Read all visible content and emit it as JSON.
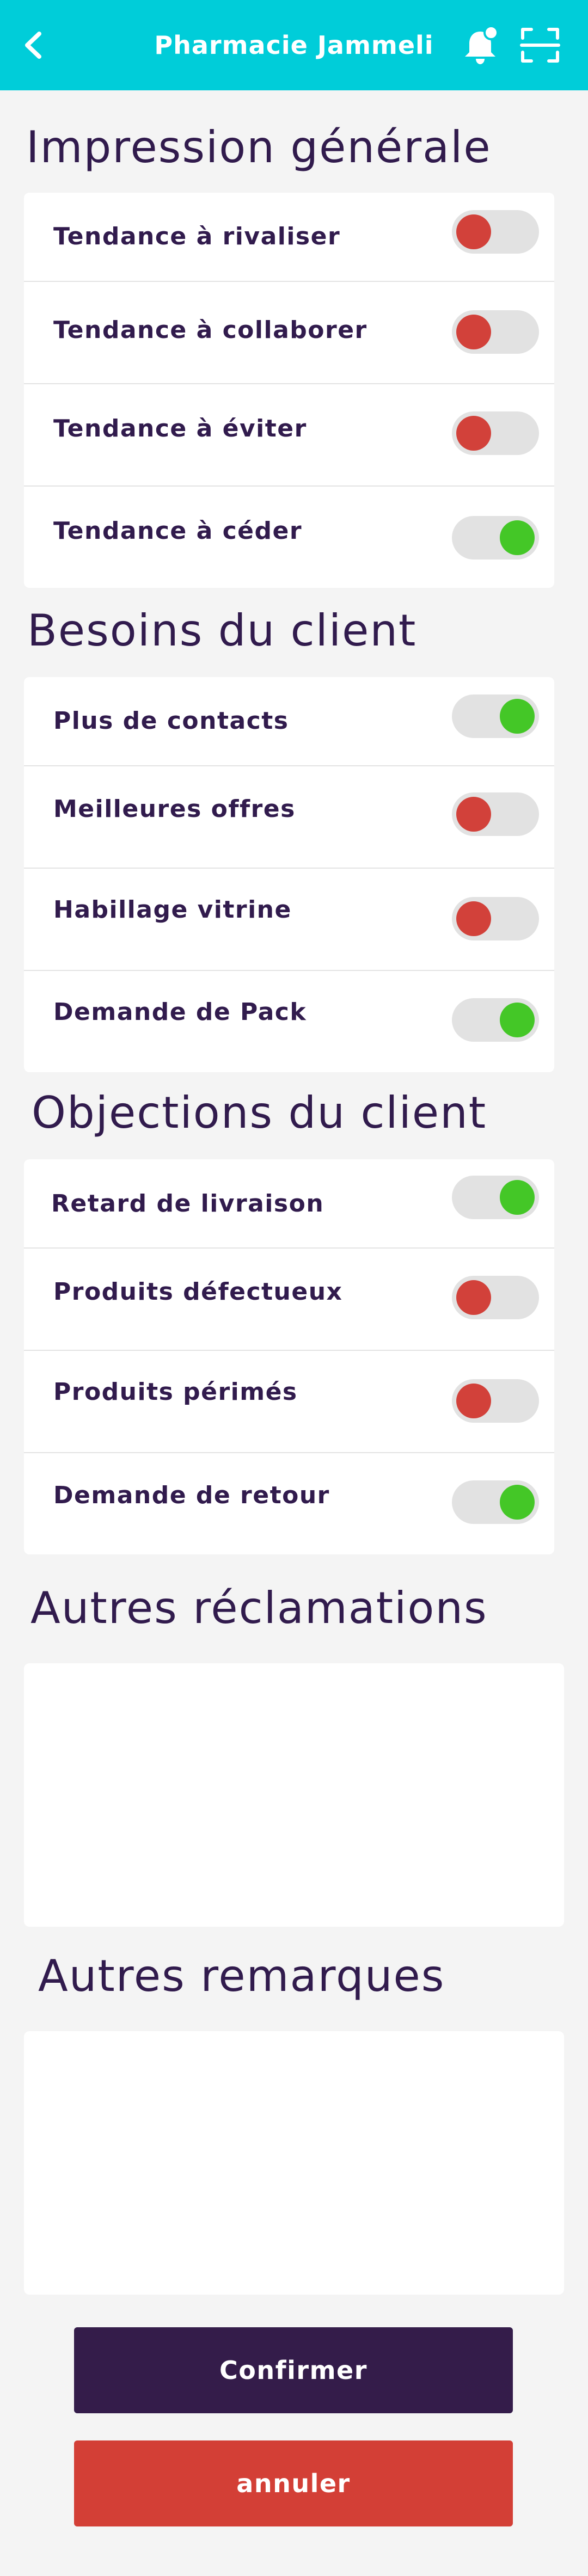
{
  "header": {
    "title": "Pharmacie Jammeli",
    "back_icon": "chevron-left-icon",
    "bell_icon": "notification-bell-icon",
    "scan_icon": "scan-icon",
    "background_color": "#00cdd9"
  },
  "sections": [
    {
      "title": "Impression générale",
      "items": [
        {
          "label": "Tendance à rivaliser",
          "state": "off"
        },
        {
          "label": "Tendance à collaborer",
          "state": "off"
        },
        {
          "label": "Tendance à éviter",
          "state": "off"
        },
        {
          "label": "Tendance à céder",
          "state": "on"
        }
      ]
    },
    {
      "title": "Besoins du client",
      "items": [
        {
          "label": "Plus de contacts",
          "state": "on"
        },
        {
          "label": "Meilleures offres",
          "state": "off"
        },
        {
          "label": "Habillage vitrine",
          "state": "off"
        },
        {
          "label": "Demande de Pack",
          "state": "on"
        }
      ]
    },
    {
      "title": "Objections du client",
      "items": [
        {
          "label": "Retard de livraison",
          "state": "on"
        },
        {
          "label": "Produits défectueux",
          "state": "off"
        },
        {
          "label": "Produits périmés",
          "state": "off"
        },
        {
          "label": "Demande de retour",
          "state": "on"
        }
      ]
    }
  ],
  "other_claims": {
    "title": "Autres réclamations",
    "value": ""
  },
  "other_remarks": {
    "title": "Autres remarques",
    "value": ""
  },
  "buttons": {
    "confirm": "Confirmer",
    "cancel": "annuler"
  },
  "colors": {
    "title_text": "#311b4d",
    "toggle_on": "#44c727",
    "toggle_off": "#d2413a",
    "confirm_button": "#341c4a",
    "cancel_button": "#d33f36"
  }
}
